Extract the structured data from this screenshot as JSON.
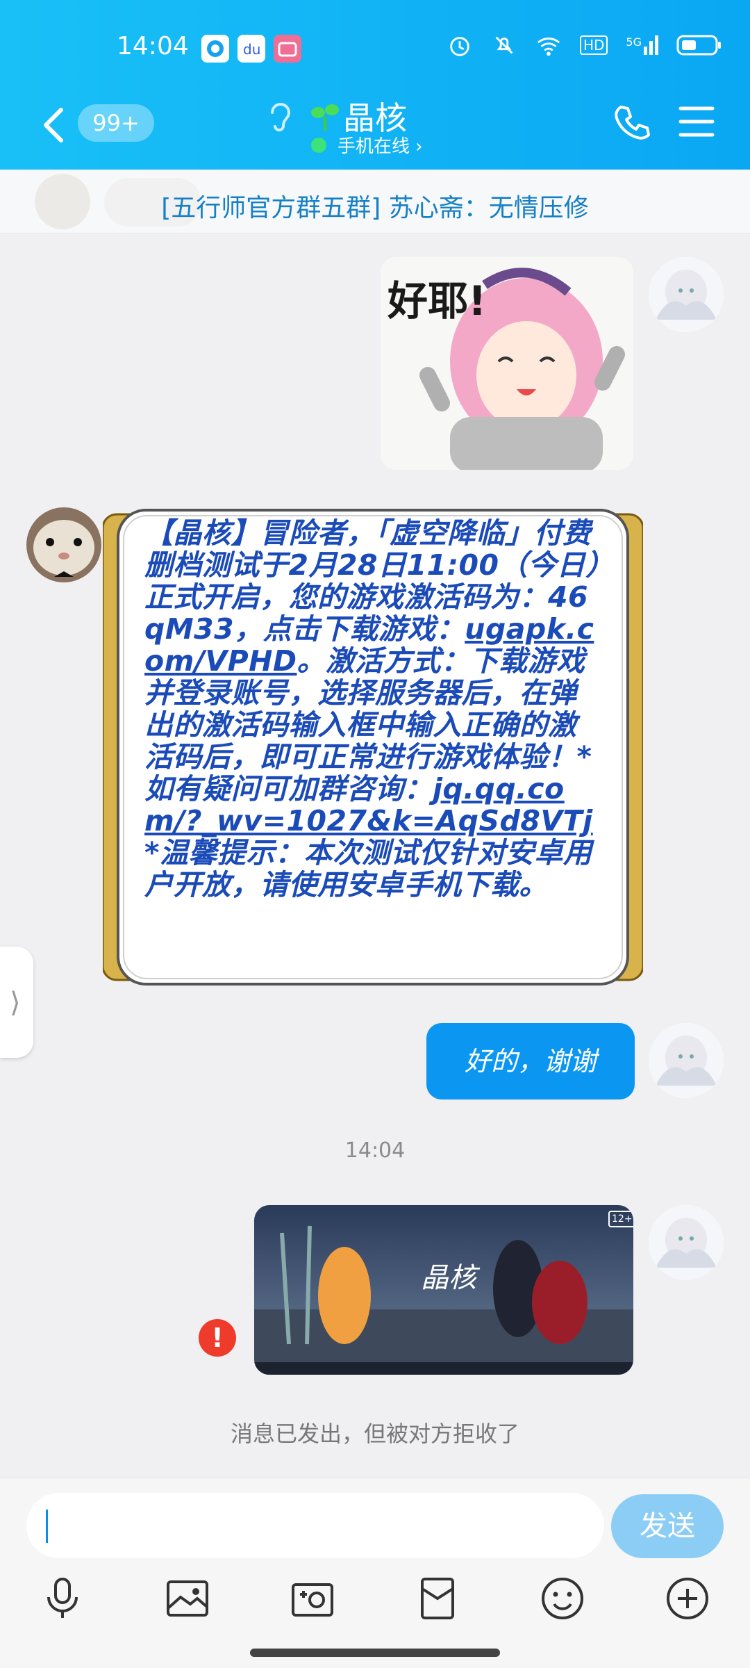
{
  "status_bar": {
    "time": "14:04",
    "hd_label": "HD",
    "net_label": "5G"
  },
  "header": {
    "unread_badge": "99+",
    "contact_name": "晶核",
    "online_status": "手机在线 ›"
  },
  "banner": {
    "text": "[五行师官方群五群] 苏心斋：无情压修"
  },
  "messages": [
    {
      "from": "self",
      "type": "sticker",
      "caption": "好耶!"
    },
    {
      "from": "contact",
      "type": "scroll-text",
      "text_before_link1": "【晶核】冒险者，「虚空降临」付费删档测试于2月28日11:00（今日）正式开启，您的游戏激活码为：46qM33，点击下载游戏：",
      "link1": "ugapk.com/VPHD",
      "text_after_link1": "。激活方式：下载游戏并登录账号，选择服务器后，在弹出的激活码输入框中输入正确的激活码后，即可正常进行游戏体验！*如有疑问可加群咨询：",
      "link2": "jq.qq.com/?_wv=1027&k=AqSd8VTj",
      "text_after_link2": "*温馨提示：本次测试仅针对安卓用户开放，请使用安卓手机下载。"
    },
    {
      "from": "self",
      "type": "text",
      "text": "好的，谢谢"
    },
    {
      "from": "system",
      "type": "timestamp",
      "text": "14:04"
    },
    {
      "from": "self",
      "type": "image",
      "image_title": "晶核",
      "age_rating": "12+",
      "failed": true,
      "error_icon": "!"
    },
    {
      "from": "system",
      "type": "notice",
      "text": "消息已发出，但被对方拒收了"
    }
  ],
  "input": {
    "placeholder": "",
    "send_label": "发送"
  },
  "toolbar": {
    "icons": [
      "microphone-icon",
      "photo-icon",
      "camera-icon",
      "red-packet-icon",
      "emoji-icon",
      "plus-icon"
    ]
  },
  "colors": {
    "header": "#0aa7f3",
    "bubble_self": "#0b96f1",
    "link_text": "#1a4bb8",
    "error": "#ee3b2b",
    "send_button": "#8ccdf6"
  }
}
